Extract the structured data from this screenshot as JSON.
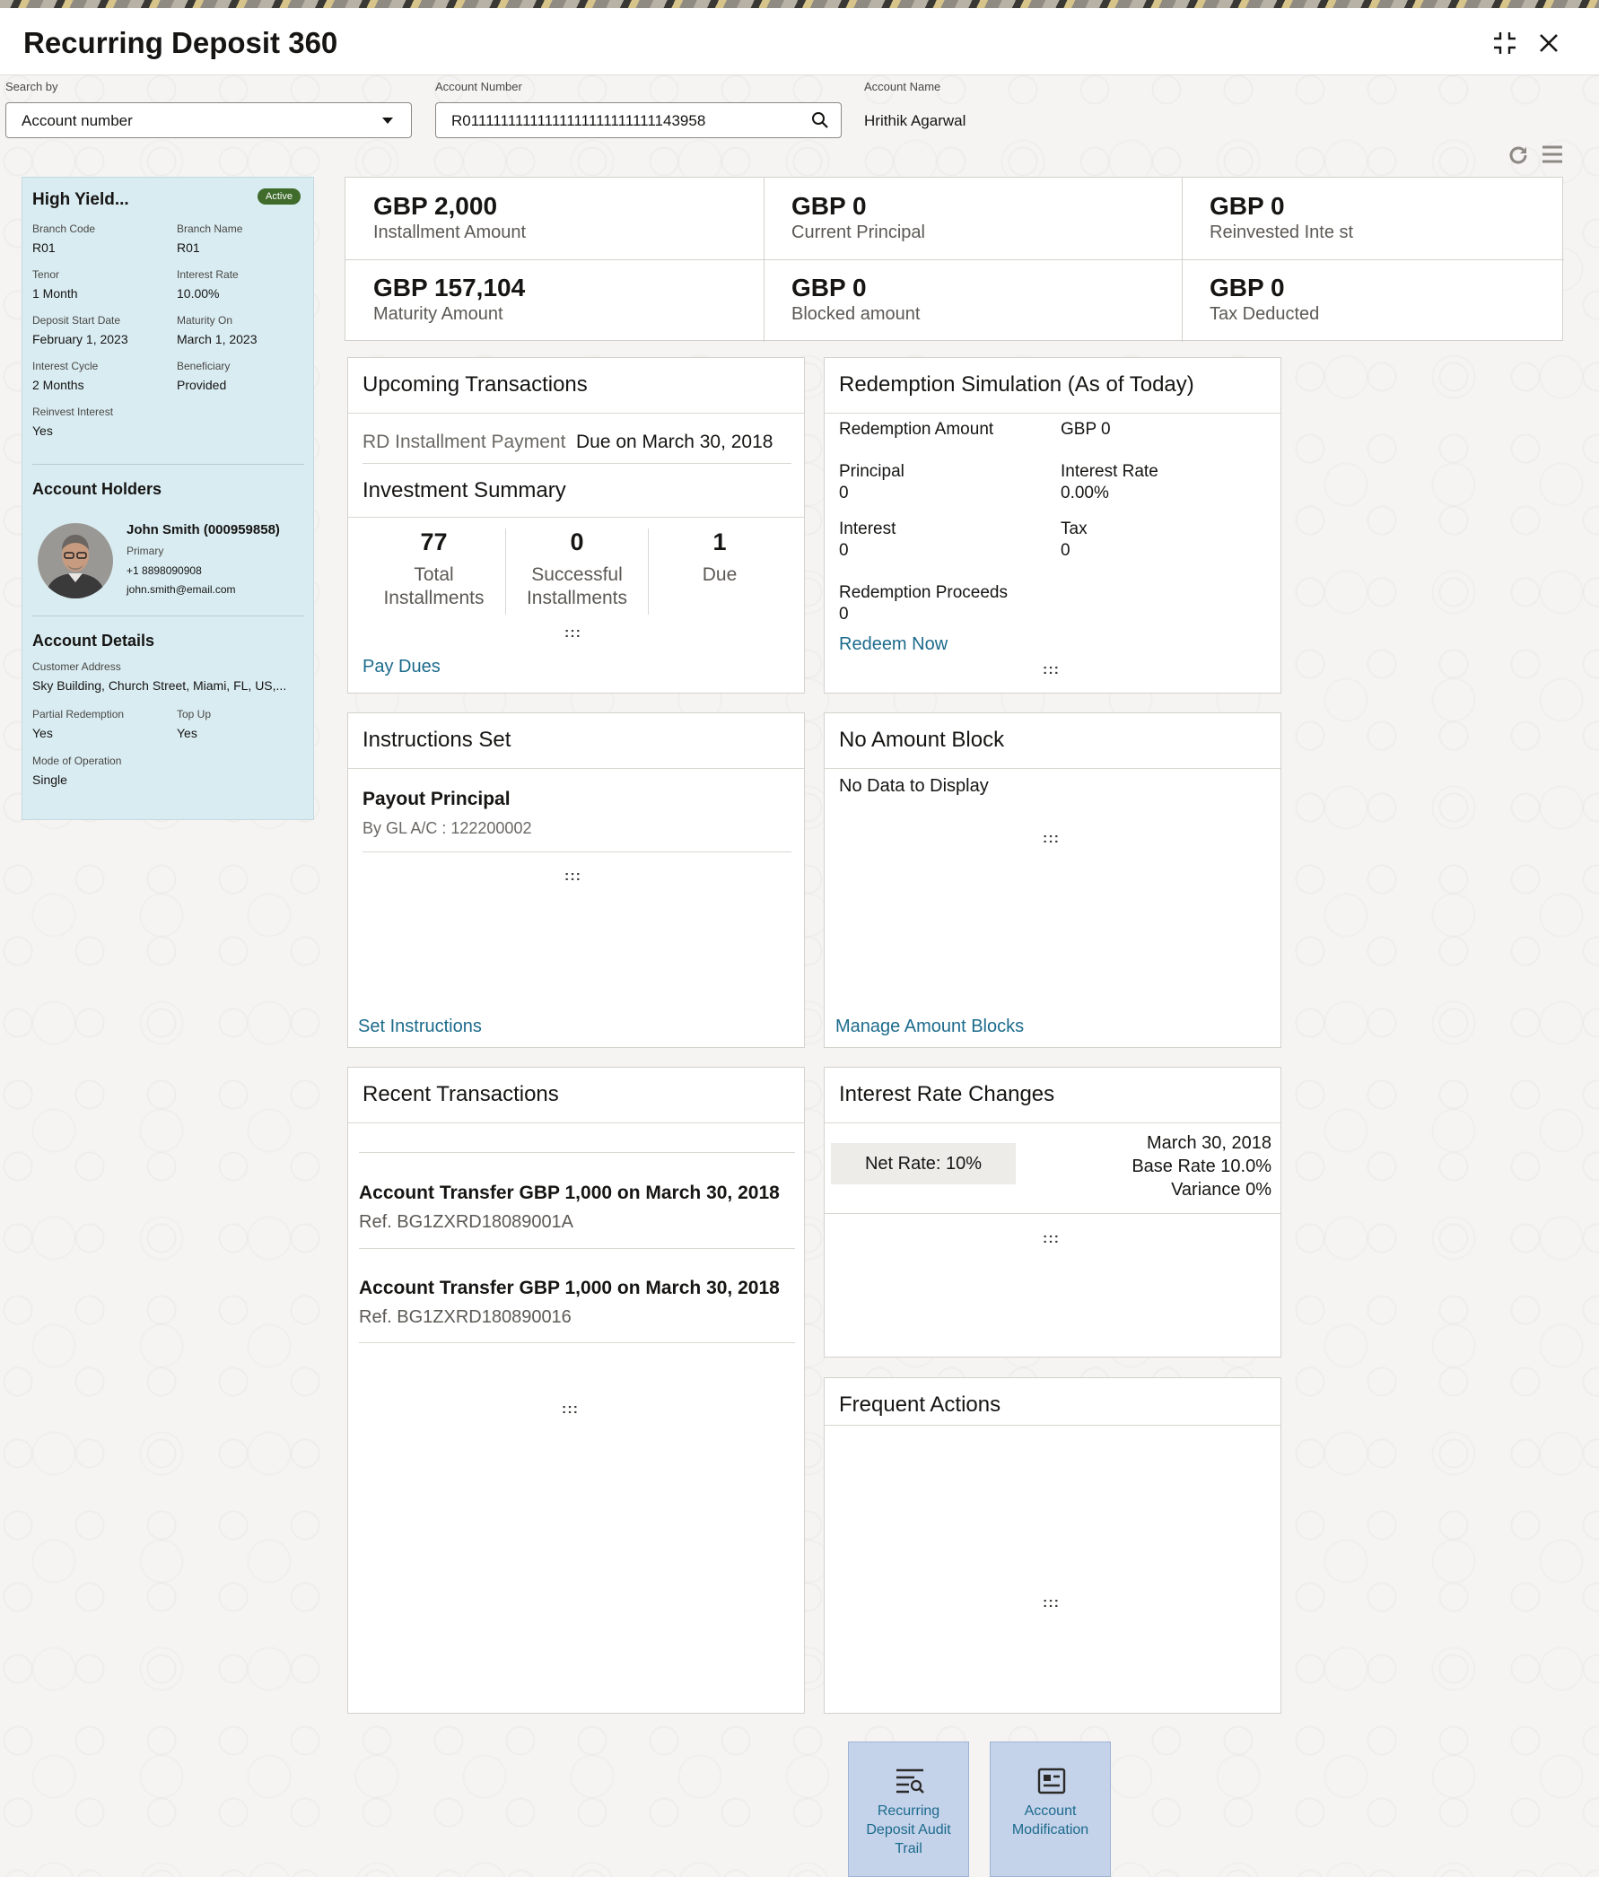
{
  "window": {
    "title": "Recurring Deposit 360"
  },
  "search": {
    "search_by_label": "Search by",
    "search_by_value": "Account number",
    "account_number_label": "Account Number",
    "account_number_value": "R01111111111111111111111111143958",
    "account_name_label": "Account Name",
    "account_name_value": "Hrithik Agarwal"
  },
  "sidebar": {
    "product_name": "High Yield...",
    "status": "Active",
    "fields": [
      {
        "label": "Branch Code",
        "value": "R01"
      },
      {
        "label": "Branch Name",
        "value": "R01"
      },
      {
        "label": "Tenor",
        "value": "1 Month"
      },
      {
        "label": "Interest Rate",
        "value": "10.00%"
      },
      {
        "label": "Deposit Start Date",
        "value": "February 1, 2023"
      },
      {
        "label": "Maturity On",
        "value": "March 1, 2023"
      },
      {
        "label": "Interest Cycle",
        "value": "2 Months"
      },
      {
        "label": "Beneficiary",
        "value": "Provided"
      },
      {
        "label": "Reinvest Interest",
        "value": "Yes"
      }
    ],
    "holders_heading": "Account Holders",
    "holder": {
      "name": "John Smith (000959858)",
      "role": "Primary",
      "phone": "+1 8898090908",
      "email": "john.smith@email.com"
    },
    "details_heading": "Account Details",
    "details": [
      {
        "label": "Customer Address",
        "value": "Sky Building, Church Street, Miami, FL, US,..."
      },
      {
        "label": "Partial Redemption",
        "value": "Yes"
      },
      {
        "label": "Top Up",
        "value": "Yes"
      },
      {
        "label": "Mode of Operation",
        "value": "Single"
      }
    ]
  },
  "metrics": [
    {
      "value": "GBP 2,000",
      "label": "Installment Amount"
    },
    {
      "value": "GBP 0",
      "label": "Current Principal"
    },
    {
      "value": "GBP 0",
      "label": "Reinvested Inte st"
    },
    {
      "value": "GBP 157,104",
      "label": "Maturity Amount"
    },
    {
      "value": "GBP 0",
      "label": "Blocked amount"
    },
    {
      "value": "GBP 0",
      "label": "Tax Deducted"
    }
  ],
  "upcoming": {
    "title": "Upcoming Transactions",
    "item_label": "RD Installment Payment",
    "item_due": "Due on March 30, 2018",
    "summary_title": "Investment Summary",
    "stats": [
      {
        "value": "77",
        "label": "Total Installments"
      },
      {
        "value": "0",
        "label": "Successful Installments"
      },
      {
        "value": "1",
        "label": "Due"
      }
    ],
    "action": "Pay Dues"
  },
  "redemption": {
    "title": "Redemption Simulation (As of Today)",
    "amount_label": "Redemption Amount",
    "amount_value": "GBP 0",
    "principal_label": "Principal",
    "principal_value": "0",
    "rate_label": "Interest Rate",
    "rate_value": "0.00%",
    "interest_label": "Interest",
    "interest_value": "0",
    "tax_label": "Tax",
    "tax_value": "0",
    "proceeds_label": "Redemption Proceeds",
    "proceeds_value": "0",
    "action": "Redeem Now"
  },
  "instructions": {
    "title": "Instructions Set",
    "item_title": "Payout Principal",
    "item_sub": "By GL A/C : 122200002",
    "action": "Set Instructions"
  },
  "amount_block": {
    "title": "No Amount Block",
    "empty": "No Data to Display",
    "action": "Manage Amount Blocks"
  },
  "recent": {
    "title": "Recent Transactions",
    "items": [
      {
        "title": "Account Transfer GBP 1,000 on March 30, 2018",
        "ref": "Ref. BG1ZXRD18089001A"
      },
      {
        "title": "Account Transfer GBP 1,000 on March 30, 2018",
        "ref": "Ref. BG1ZXRD180890016"
      }
    ]
  },
  "rate_changes": {
    "title": "Interest Rate Changes",
    "net_rate": "Net Rate: 10%",
    "date": "March 30, 2018",
    "base_rate": "Base Rate 10.0%",
    "variance": "Variance 0%"
  },
  "frequent": {
    "title": "Frequent Actions",
    "tiles": [
      {
        "label": "Recurring Deposit Audit Trail",
        "icon": "audit-trail-icon"
      },
      {
        "label": "Account Modification",
        "icon": "account-modification-icon"
      }
    ]
  },
  "grip": ":::",
  "colors": {
    "link": "#1c6b8c",
    "sidebar_bg": "#d9ecf2",
    "active_badge": "#3f6b2b",
    "tile_bg": "#c4d2ea"
  }
}
